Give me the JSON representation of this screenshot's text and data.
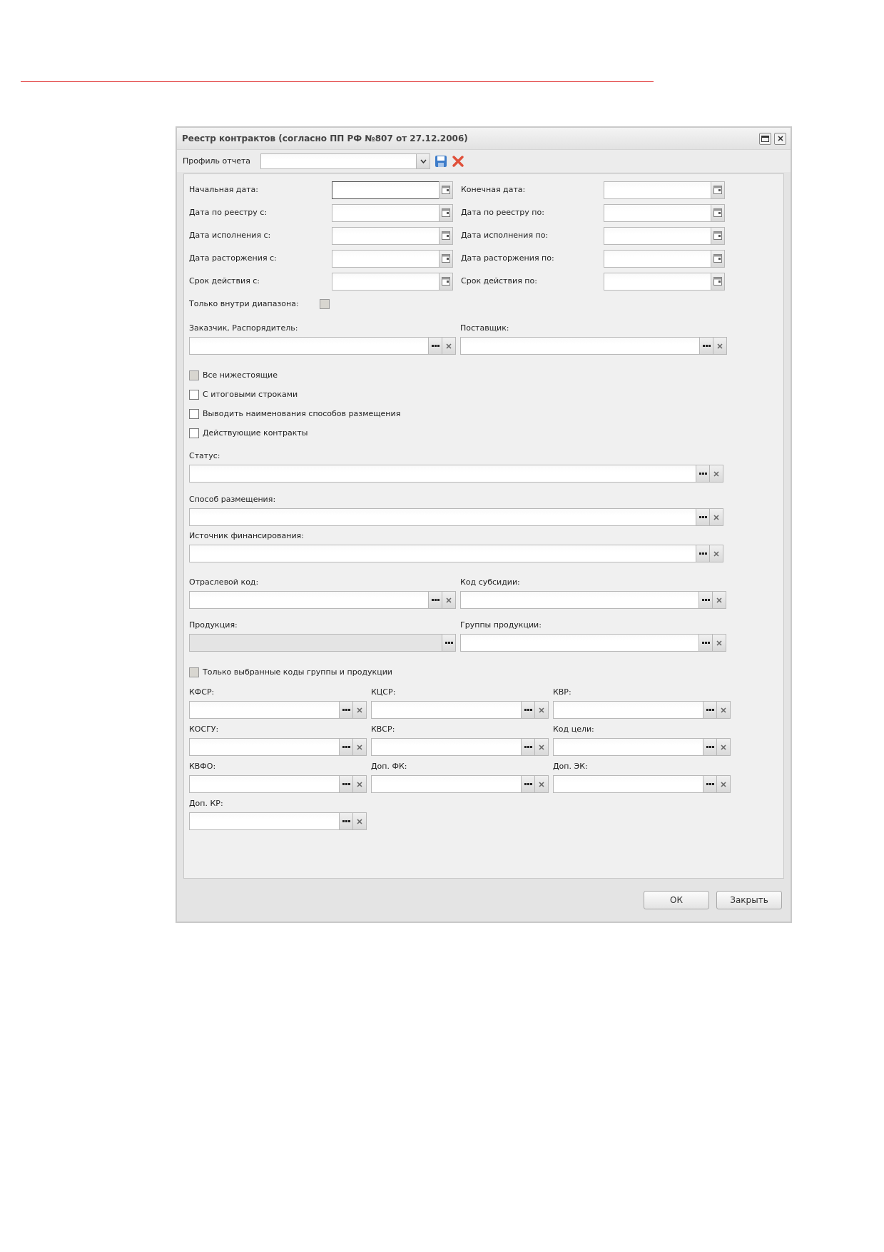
{
  "window": {
    "title": "Реестр контрактов (согласно ПП РФ №807 от 27.12.2006)"
  },
  "toolbar": {
    "profile_label": "Профиль отчета"
  },
  "date_rows": [
    {
      "left": {
        "label": "Начальная дата:",
        "focused": true
      },
      "right": {
        "label": "Конечная дата:",
        "focused": false
      }
    },
    {
      "left": {
        "label": "Дата по реестру с:",
        "focused": false
      },
      "right": {
        "label": "Дата по реестру по:",
        "focused": false
      }
    },
    {
      "left": {
        "label": "Дата исполнения с:",
        "focused": false
      },
      "right": {
        "label": "Дата исполнения по:",
        "focused": false
      }
    },
    {
      "left": {
        "label": "Дата расторжения с:",
        "focused": false
      },
      "right": {
        "label": "Дата расторжения по:",
        "focused": false
      }
    },
    {
      "left": {
        "label": "Срок действия с:",
        "focused": false
      },
      "right": {
        "label": "Срок действия по:",
        "focused": false
      }
    }
  ],
  "range_only": {
    "label": "Только внутри диапазона:",
    "checked": false,
    "disabled": true
  },
  "parties": [
    {
      "label": "Заказчик, Распорядитель:",
      "disabled": false
    },
    {
      "label": "Поставщик:",
      "disabled": false
    }
  ],
  "options": [
    {
      "label": "Все нижестоящие",
      "checked": false,
      "disabled": true
    },
    {
      "label": "С итоговыми строками",
      "checked": false,
      "disabled": false
    },
    {
      "label": "Выводить наименования способов размещения",
      "checked": false,
      "disabled": false
    },
    {
      "label": "Действующие контракты",
      "checked": false,
      "disabled": false
    }
  ],
  "wide_fields": [
    {
      "label": "Статус:",
      "disabled": false
    },
    {
      "label": "Способ размещения:",
      "disabled": false
    },
    {
      "label": "Источник финансирования:",
      "disabled": false
    }
  ],
  "pair_rows": [
    [
      {
        "label": "Отраслевой код:",
        "disabled": false
      },
      {
        "label": "Код субсидии:",
        "disabled": false
      }
    ],
    [
      {
        "label": "Продукция:",
        "disabled": true
      },
      {
        "label": "Группы продукции:",
        "disabled": false
      }
    ]
  ],
  "selected_codes_only": {
    "label": "Только выбранные коды группы и продукции",
    "checked": false,
    "disabled": true
  },
  "code_fields": [
    {
      "label": "КФСР:",
      "disabled": false
    },
    {
      "label": "КЦСР:",
      "disabled": false
    },
    {
      "label": "КВР:",
      "disabled": false
    },
    {
      "label": "КОСГУ:",
      "disabled": false
    },
    {
      "label": "КВСР:",
      "disabled": false
    },
    {
      "label": "Код цели:",
      "disabled": false
    },
    {
      "label": "КВФО:",
      "disabled": false
    },
    {
      "label": "Доп. ФК:",
      "disabled": false
    },
    {
      "label": "Доп. ЭК:",
      "disabled": false
    },
    {
      "label": "Доп. КР:",
      "disabled": false
    }
  ],
  "buttons": [
    {
      "label": "ОК"
    },
    {
      "label": "Закрыть"
    }
  ]
}
